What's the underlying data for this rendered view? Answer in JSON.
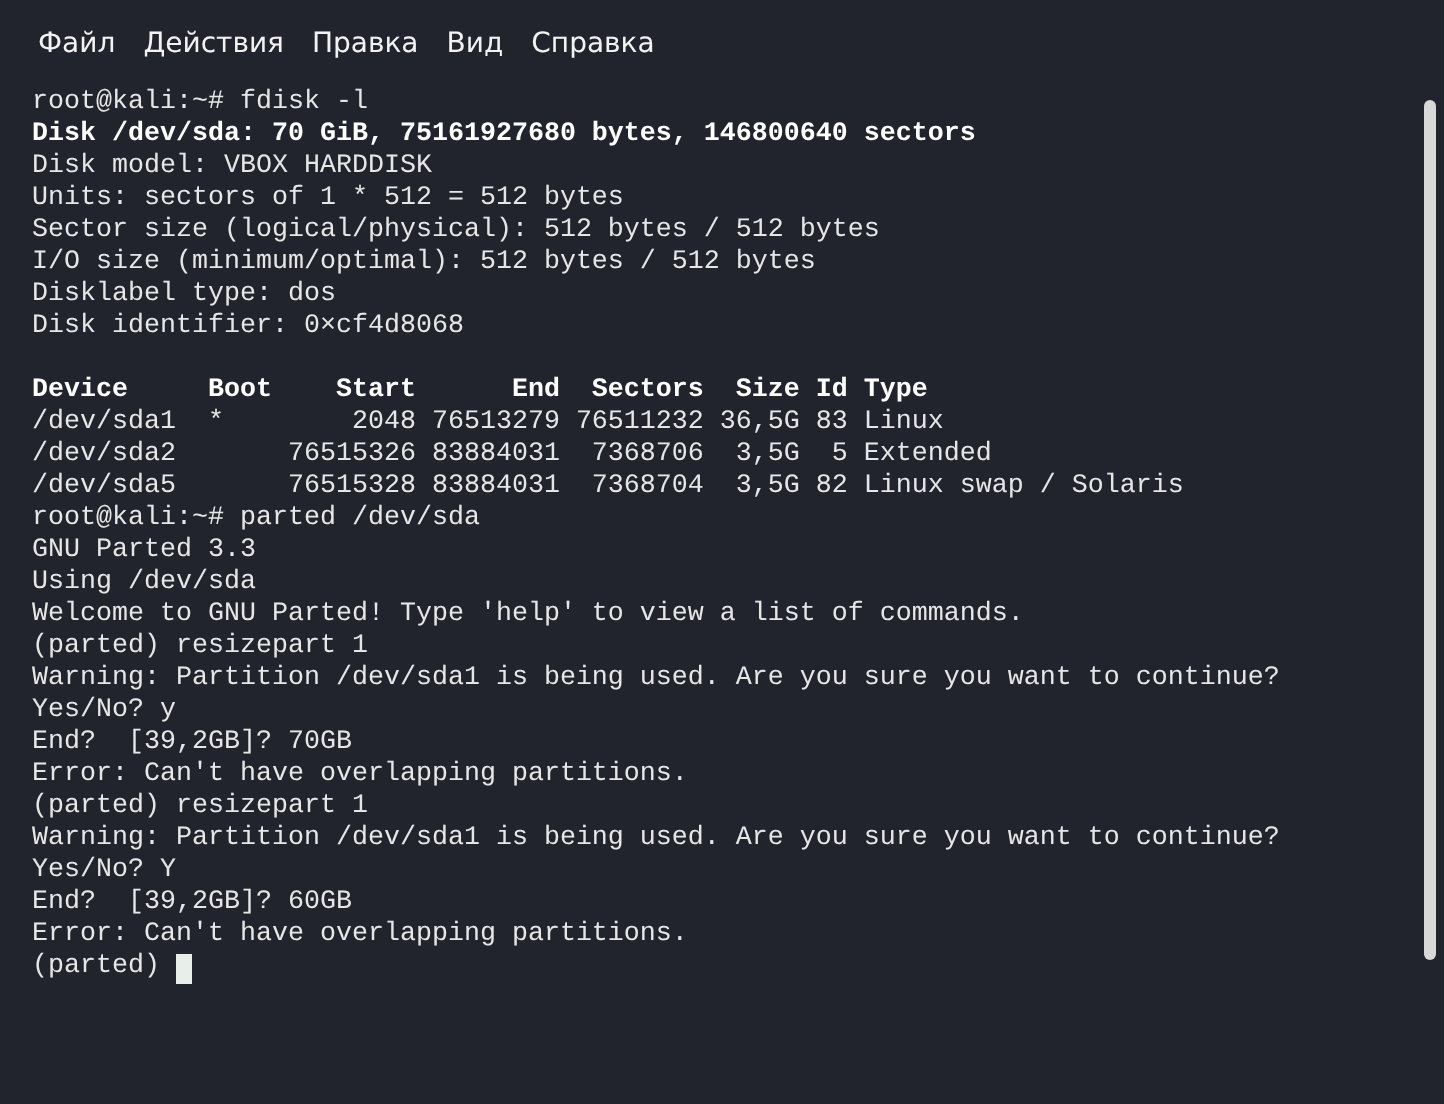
{
  "menu": [
    "Файл",
    "Действия",
    "Правка",
    "Вид",
    "Справка"
  ],
  "terminal": {
    "cursor": true,
    "blocks": [
      [
        {
          "text": "root@kali:~# fdisk -l",
          "bold": false
        },
        {
          "text": "Disk /dev/sda: 70 GiB, 75161927680 bytes, 146800640 sectors",
          "bold": true
        },
        {
          "text": "Disk model: VBOX HARDDISK",
          "bold": false
        },
        {
          "text": "Units: sectors of 1 * 512 = 512 bytes",
          "bold": false
        },
        {
          "text": "Sector size (logical/physical): 512 bytes / 512 bytes",
          "bold": false
        },
        {
          "text": "I/O size (minimum/optimal): 512 bytes / 512 bytes",
          "bold": false
        },
        {
          "text": "Disklabel type: dos",
          "bold": false
        },
        {
          "text": "Disk identifier: 0×cf4d8068",
          "bold": false
        }
      ],
      [
        {
          "text": "Device     Boot    Start      End  Sectors  Size Id Type",
          "bold": true
        },
        {
          "text": "/dev/sda1  *        2048 76513279 76511232 36,5G 83 Linux",
          "bold": false
        },
        {
          "text": "/dev/sda2       76515326 83884031  7368706  3,5G  5 Extended",
          "bold": false
        },
        {
          "text": "/dev/sda5       76515328 83884031  7368704  3,5G 82 Linux swap / Solaris",
          "bold": false
        },
        {
          "text": "root@kali:~# parted /dev/sda",
          "bold": false
        },
        {
          "text": "GNU Parted 3.3",
          "bold": false
        },
        {
          "text": "Using /dev/sda",
          "bold": false
        },
        {
          "text": "Welcome to GNU Parted! Type 'help' to view a list of commands.",
          "bold": false
        },
        {
          "text": "(parted) resizepart 1",
          "bold": false
        },
        {
          "text": "Warning: Partition /dev/sda1 is being used. Are you sure you want to continue?",
          "bold": false
        },
        {
          "text": "Yes/No? y",
          "bold": false
        },
        {
          "text": "End?  [39,2GB]? 70GB",
          "bold": false
        },
        {
          "text": "Error: Can't have overlapping partitions.",
          "bold": false
        },
        {
          "text": "(parted) resizepart 1",
          "bold": false
        },
        {
          "text": "Warning: Partition /dev/sda1 is being used. Are you sure you want to continue?",
          "bold": false
        },
        {
          "text": "Yes/No? Y",
          "bold": false
        },
        {
          "text": "End?  [39,2GB]? 60GB",
          "bold": false
        },
        {
          "text": "Error: Can't have overlapping partitions.",
          "bold": false
        },
        {
          "text": "(parted)",
          "bold": false
        }
      ]
    ]
  }
}
